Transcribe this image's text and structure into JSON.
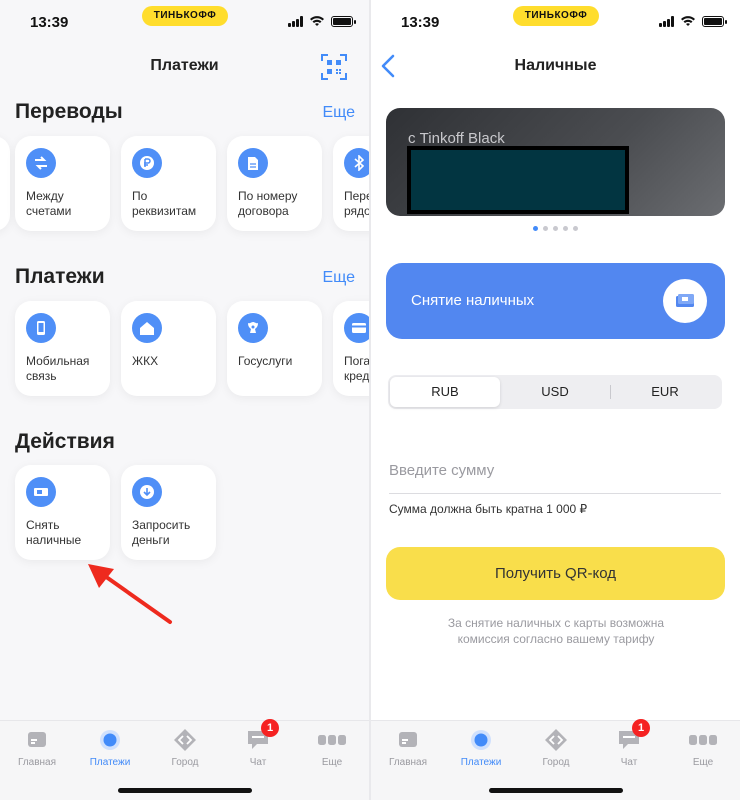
{
  "status": {
    "time": "13:39",
    "brand": "ТИНЬКОФФ"
  },
  "left": {
    "title": "Платежи",
    "transfers": {
      "title": "Переводы",
      "more": "Еще",
      "tiles": [
        {
          "label": "Между\nсчетами",
          "icon": "transfer-icon"
        },
        {
          "label": "По\nреквизитам",
          "icon": "ruble-icon"
        },
        {
          "label": "По номеру\nдоговора",
          "icon": "document-icon"
        },
        {
          "label": "Пере\nрядо",
          "icon": "bluetooth-icon"
        }
      ]
    },
    "payments": {
      "title": "Платежи",
      "more": "Еще",
      "tiles": [
        {
          "label": "Мобильная\nсвязь",
          "icon": "phone-icon"
        },
        {
          "label": "ЖКХ",
          "icon": "house-icon"
        },
        {
          "label": "Госуслуги",
          "icon": "emblem-icon"
        },
        {
          "label": "Пога\nкред",
          "icon": "card-icon"
        }
      ]
    },
    "actions": {
      "title": "Действия",
      "tiles": [
        {
          "label": "Снять\nналичные",
          "icon": "cash-icon"
        },
        {
          "label": "Запросить\nденьги",
          "icon": "download-icon"
        }
      ]
    }
  },
  "right": {
    "title": "Наличные",
    "card_label": "с Tinkoff Black",
    "cash_withdrawal": "Снятие наличных",
    "currencies": [
      "RUB",
      "USD",
      "EUR"
    ],
    "selected_currency": "RUB",
    "amount_placeholder": "Введите сумму",
    "hint": "Сумма должна быть кратна 1 000 ₽",
    "qr_button": "Получить QR-код",
    "note": "За снятие наличных с карты возможна\nкомиссия согласно вашему тарифу"
  },
  "tabbar": {
    "items": [
      {
        "label": "Главная",
        "icon": "home-card-icon"
      },
      {
        "label": "Платежи",
        "icon": "payments-icon",
        "active": true
      },
      {
        "label": "Город",
        "icon": "city-icon"
      },
      {
        "label": "Чат",
        "icon": "chat-icon",
        "badge": "1"
      },
      {
        "label": "Еще",
        "icon": "more-icon"
      }
    ]
  },
  "colors": {
    "accent": "#428bf9",
    "yellow": "#f9de4b",
    "cash_block": "#5287f0",
    "badge": "#f52222"
  }
}
